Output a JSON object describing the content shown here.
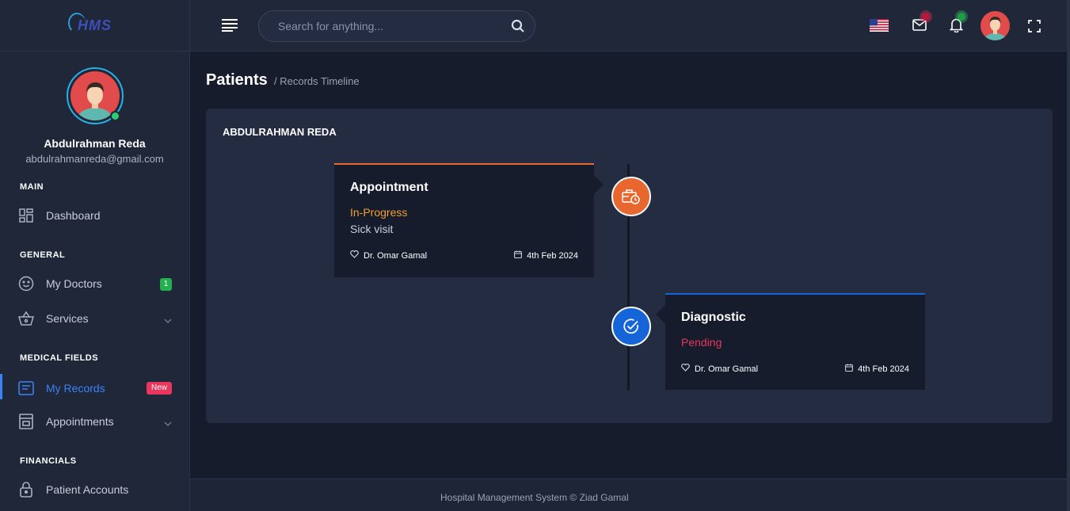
{
  "app": {
    "logo": "HMS"
  },
  "user": {
    "name": "Abdulrahman Reda",
    "email": "abdulrahmanreda@gmail.com"
  },
  "sidebar": {
    "sections": [
      {
        "title": "MAIN"
      },
      {
        "title": "GENERAL"
      },
      {
        "title": "MEDICAL FIELDS"
      },
      {
        "title": "FINANCIALS"
      }
    ],
    "items": [
      {
        "label": "Dashboard",
        "icon": "dashboard-icon"
      },
      {
        "label": "My Doctors",
        "icon": "smile-icon",
        "badge": "1"
      },
      {
        "label": "Services",
        "icon": "basket-icon"
      },
      {
        "label": "My Records",
        "icon": "records-icon",
        "badge": "New",
        "active": true
      },
      {
        "label": "Appointments",
        "icon": "calendar-box-icon"
      },
      {
        "label": "Patient Accounts",
        "icon": "lock-icon"
      }
    ]
  },
  "topbar": {
    "search_placeholder": "Search for anything...",
    "icons": [
      "menu-icon",
      "search-icon",
      "us-flag-icon",
      "mail-icon",
      "bell-icon",
      "avatar",
      "fullscreen-icon"
    ]
  },
  "page": {
    "title": "Patients",
    "breadcrumb": "/ Records Timeline"
  },
  "record": {
    "patient_name": "ABDULRAHMAN REDA",
    "entries": [
      {
        "type": "Appointment",
        "status": "In-Progress",
        "description": "Sick visit",
        "doctor": "Dr. Omar Gamal",
        "date": "4th Feb 2024",
        "color": "#e8672e",
        "status_color": "#f0a02b"
      },
      {
        "type": "Diagnostic",
        "status": "Pending",
        "description": "",
        "doctor": "Dr. Omar Gamal",
        "date": "4th Feb 2024",
        "color": "#1565d8",
        "status_color": "#e8365c"
      }
    ]
  },
  "footer": {
    "text": "Hospital Management System © Ziad Gamal"
  }
}
